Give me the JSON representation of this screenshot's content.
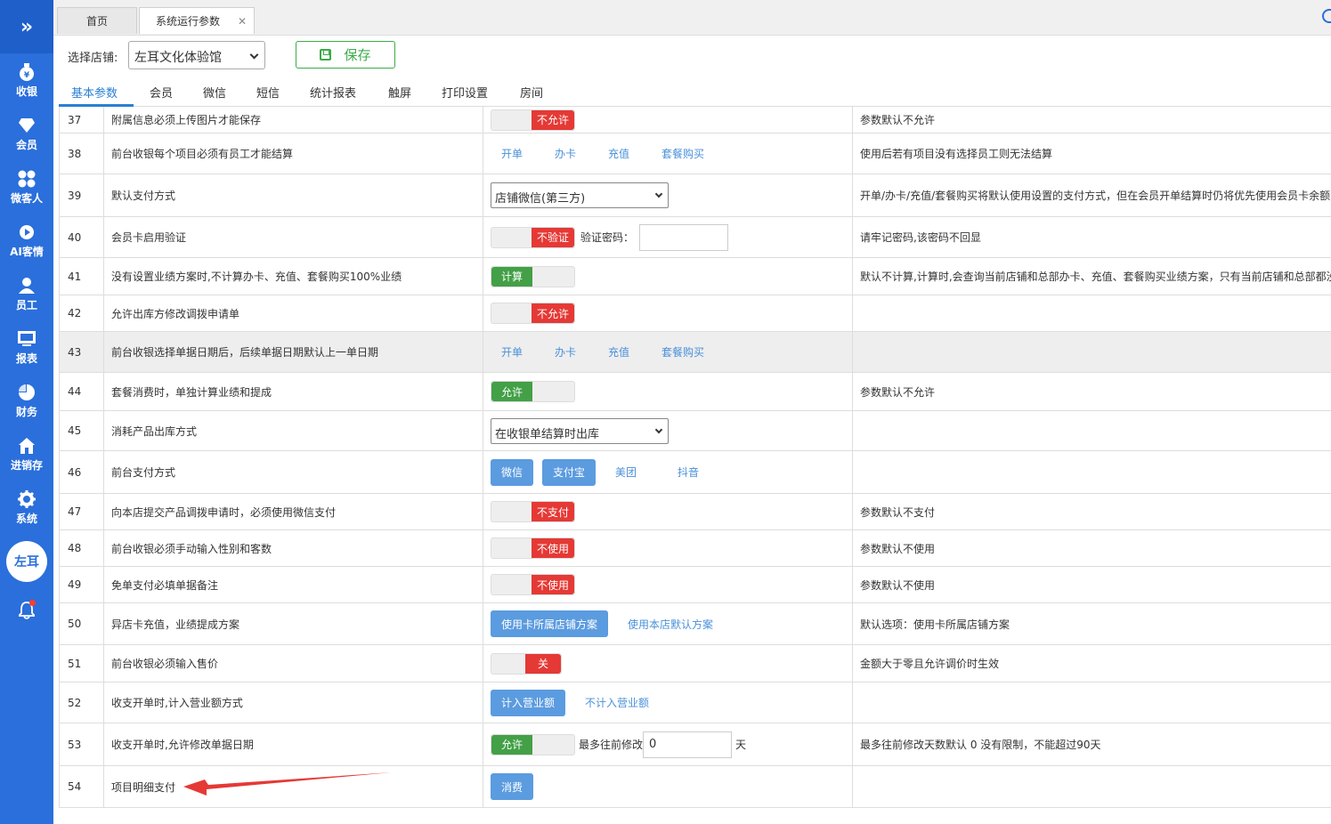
{
  "sidebar": {
    "items": [
      {
        "label": "收银",
        "icon": "yen-bag-icon"
      },
      {
        "label": "会员",
        "icon": "diamond-icon"
      },
      {
        "label": "微客人",
        "icon": "clover-icon"
      },
      {
        "label": "AI客情",
        "icon": "play-circle-icon"
      },
      {
        "label": "员工",
        "icon": "person-icon"
      },
      {
        "label": "报表",
        "icon": "monitor-icon"
      },
      {
        "label": "财务",
        "icon": "pie-chart-icon"
      },
      {
        "label": "进销存",
        "icon": "house-icon"
      },
      {
        "label": "系统",
        "icon": "gear-icon"
      }
    ],
    "avatar": "左耳"
  },
  "tabs": {
    "home": "首页",
    "active": "系统运行参数"
  },
  "toolbar": {
    "store_label": "选择店铺:",
    "store_value": "左耳文化体验馆",
    "save_label": "保存"
  },
  "subtabs": [
    "基本参数",
    "会员",
    "微信",
    "短信",
    "统计报表",
    "触屏",
    "打印设置",
    "房间"
  ],
  "rows": [
    {
      "num": "37",
      "name": "附属信息必须上传图片才能保存",
      "toggle": "不允许",
      "desc": "参数默认不允许"
    },
    {
      "num": "38",
      "name": "前台收银每个项目必须有员工才能结算",
      "opts": [
        "开单",
        "办卡",
        "充值",
        "套餐购买"
      ],
      "desc": "使用后若有项目没有选择员工则无法结算"
    },
    {
      "num": "39",
      "name": "默认支付方式",
      "select": "店铺微信(第三方)",
      "desc": "开单/办卡/充值/套餐购买将默认使用设置的支付方式，但在会员开单结算时仍将优先使用会员卡余额"
    },
    {
      "num": "40",
      "name": "会员卡启用验证",
      "toggle": "不验证",
      "label": "验证密码：",
      "desc": "请牢记密码,该密码不回显"
    },
    {
      "num": "41",
      "name": "没有设置业绩方案时,不计算办卡、充值、套餐购买100%业绩",
      "toggle": "计算",
      "desc": "默认不计算,计算时,会查询当前店铺和总部办卡、充值、套餐购买业绩方案，只有当前店铺和总部都没有"
    },
    {
      "num": "42",
      "name": "允许出库方修改调拨申请单",
      "toggle": "不允许",
      "desc": ""
    },
    {
      "num": "43",
      "name": "前台收银选择单据日期后，后续单据日期默认上一单日期",
      "opts": [
        "开单",
        "办卡",
        "充值",
        "套餐购买"
      ],
      "desc": ""
    },
    {
      "num": "44",
      "name": "套餐消费时，单独计算业绩和提成",
      "toggle": "允许",
      "desc": "参数默认不允许"
    },
    {
      "num": "45",
      "name": "消耗产品出库方式",
      "select": "在收银单结算时出库",
      "desc": ""
    },
    {
      "num": "46",
      "name": "前台支付方式",
      "btns": [
        "微信",
        "支付宝"
      ],
      "opts": [
        "美团",
        "抖音"
      ],
      "desc": ""
    },
    {
      "num": "47",
      "name": "向本店提交产品调拨申请时，必须使用微信支付",
      "toggle": "不支付",
      "desc": "参数默认不支付"
    },
    {
      "num": "48",
      "name": "前台收银必须手动输入性别和客数",
      "toggle": "不使用",
      "desc": "参数默认不使用"
    },
    {
      "num": "49",
      "name": "免单支付必填单据备注",
      "toggle": "不使用",
      "desc": "参数默认不使用"
    },
    {
      "num": "50",
      "name": "异店卡充值，业绩提成方案",
      "btns": [
        "使用卡所属店铺方案"
      ],
      "opts": [
        "使用本店默认方案"
      ],
      "desc": "默认选项：使用卡所属店铺方案"
    },
    {
      "num": "51",
      "name": "前台收银必须输入售价",
      "toggle": "关",
      "desc": "金额大于零且允许调价时生效"
    },
    {
      "num": "52",
      "name": "收支开单时,计入营业额方式",
      "btns": [
        "计入营业额"
      ],
      "opts": [
        "不计入营业额"
      ],
      "desc": ""
    },
    {
      "num": "53",
      "name": "收支开单时,允许修改单据日期",
      "toggle": "允许",
      "label": "最多往前修改",
      "input": "0",
      "unit": "天",
      "desc": "最多往前修改天数默认 0 没有限制，不能超过90天"
    },
    {
      "num": "54",
      "name": "项目明细支付",
      "btns": [
        "消费"
      ],
      "desc": ""
    }
  ],
  "colors": {
    "sidebar": "#2a6fdb",
    "accent": "#2a7fd4",
    "on": "#43a047",
    "off": "#e53935",
    "option_button": "#5b9bdf"
  }
}
